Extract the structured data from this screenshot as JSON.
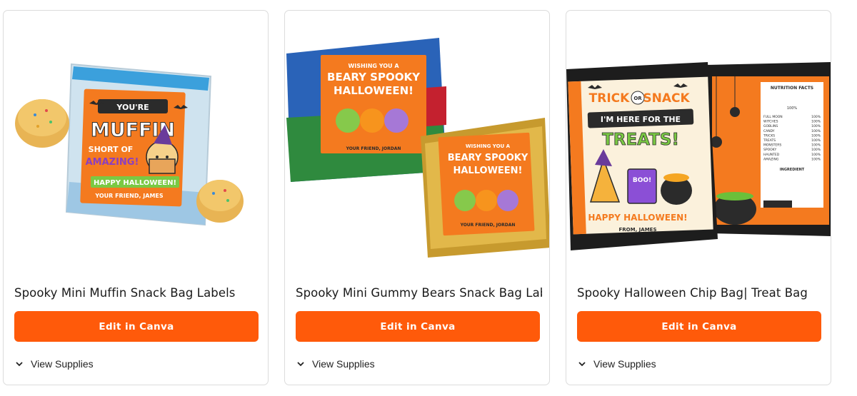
{
  "cards": [
    {
      "title": "Spooky Mini Muffin Snack Bag Labels",
      "button_label": "Edit in Canva",
      "supplies_label": "View Supplies",
      "label": {
        "line1": "YOU'RE",
        "line2": "MUFFIN",
        "line3": "SHORT OF",
        "line4": "AMAZING!",
        "banner": "HAPPY HALLOWEEN!",
        "signoff": "YOUR FRIEND, JAMES"
      }
    },
    {
      "title": "Spooky Mini Gummy Bears Snack Bag Labels",
      "button_label": "Edit in Canva",
      "supplies_label": "View Supplies",
      "label": {
        "wish": "WISHING YOU A",
        "headline1": "BEARY SPOOKY",
        "headline2": "HALLOWEEN!",
        "signoff": "YOUR FRIEND, JORDAN"
      }
    },
    {
      "title": "Spooky Halloween Chip Bag| Treat Bag",
      "button_label": "Edit in Canva",
      "supplies_label": "View Supplies",
      "label": {
        "trick": "TRICK",
        "or": "OR",
        "snack": "SNACK",
        "here": "I'M HERE FOR THE",
        "treats": "TREATS!",
        "boo": "BOO!",
        "banner": "HAPPY HALLOWEEN!",
        "from": "FROM, JAMES",
        "facts_title": "NUTRITION FACTS",
        "facts_rows": [
          "FULL MOON",
          "WITCHES",
          "GOBLINS",
          "CANDY",
          "TRICKS",
          "TREATS",
          "MONSTERS",
          "SPOOKY",
          "HAUNTED",
          "AMAZING"
        ],
        "facts_percent": "100%",
        "ingredient": "INGREDIENT"
      }
    }
  ],
  "colors": {
    "button": "#ff5a0a",
    "label_orange": "#f47a1f",
    "banner_green": "#7ac943"
  }
}
